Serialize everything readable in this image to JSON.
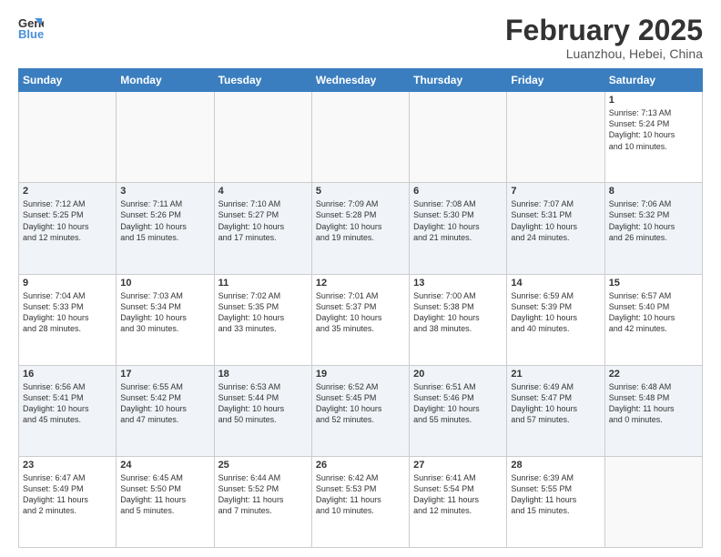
{
  "header": {
    "logo_line1": "General",
    "logo_line2": "Blue",
    "month": "February 2025",
    "location": "Luanzhou, Hebei, China"
  },
  "weekdays": [
    "Sunday",
    "Monday",
    "Tuesday",
    "Wednesday",
    "Thursday",
    "Friday",
    "Saturday"
  ],
  "weeks": [
    [
      {
        "day": "",
        "info": ""
      },
      {
        "day": "",
        "info": ""
      },
      {
        "day": "",
        "info": ""
      },
      {
        "day": "",
        "info": ""
      },
      {
        "day": "",
        "info": ""
      },
      {
        "day": "",
        "info": ""
      },
      {
        "day": "1",
        "info": "Sunrise: 7:13 AM\nSunset: 5:24 PM\nDaylight: 10 hours\nand 10 minutes."
      }
    ],
    [
      {
        "day": "2",
        "info": "Sunrise: 7:12 AM\nSunset: 5:25 PM\nDaylight: 10 hours\nand 12 minutes."
      },
      {
        "day": "3",
        "info": "Sunrise: 7:11 AM\nSunset: 5:26 PM\nDaylight: 10 hours\nand 15 minutes."
      },
      {
        "day": "4",
        "info": "Sunrise: 7:10 AM\nSunset: 5:27 PM\nDaylight: 10 hours\nand 17 minutes."
      },
      {
        "day": "5",
        "info": "Sunrise: 7:09 AM\nSunset: 5:28 PM\nDaylight: 10 hours\nand 19 minutes."
      },
      {
        "day": "6",
        "info": "Sunrise: 7:08 AM\nSunset: 5:30 PM\nDaylight: 10 hours\nand 21 minutes."
      },
      {
        "day": "7",
        "info": "Sunrise: 7:07 AM\nSunset: 5:31 PM\nDaylight: 10 hours\nand 24 minutes."
      },
      {
        "day": "8",
        "info": "Sunrise: 7:06 AM\nSunset: 5:32 PM\nDaylight: 10 hours\nand 26 minutes."
      }
    ],
    [
      {
        "day": "9",
        "info": "Sunrise: 7:04 AM\nSunset: 5:33 PM\nDaylight: 10 hours\nand 28 minutes."
      },
      {
        "day": "10",
        "info": "Sunrise: 7:03 AM\nSunset: 5:34 PM\nDaylight: 10 hours\nand 30 minutes."
      },
      {
        "day": "11",
        "info": "Sunrise: 7:02 AM\nSunset: 5:35 PM\nDaylight: 10 hours\nand 33 minutes."
      },
      {
        "day": "12",
        "info": "Sunrise: 7:01 AM\nSunset: 5:37 PM\nDaylight: 10 hours\nand 35 minutes."
      },
      {
        "day": "13",
        "info": "Sunrise: 7:00 AM\nSunset: 5:38 PM\nDaylight: 10 hours\nand 38 minutes."
      },
      {
        "day": "14",
        "info": "Sunrise: 6:59 AM\nSunset: 5:39 PM\nDaylight: 10 hours\nand 40 minutes."
      },
      {
        "day": "15",
        "info": "Sunrise: 6:57 AM\nSunset: 5:40 PM\nDaylight: 10 hours\nand 42 minutes."
      }
    ],
    [
      {
        "day": "16",
        "info": "Sunrise: 6:56 AM\nSunset: 5:41 PM\nDaylight: 10 hours\nand 45 minutes."
      },
      {
        "day": "17",
        "info": "Sunrise: 6:55 AM\nSunset: 5:42 PM\nDaylight: 10 hours\nand 47 minutes."
      },
      {
        "day": "18",
        "info": "Sunrise: 6:53 AM\nSunset: 5:44 PM\nDaylight: 10 hours\nand 50 minutes."
      },
      {
        "day": "19",
        "info": "Sunrise: 6:52 AM\nSunset: 5:45 PM\nDaylight: 10 hours\nand 52 minutes."
      },
      {
        "day": "20",
        "info": "Sunrise: 6:51 AM\nSunset: 5:46 PM\nDaylight: 10 hours\nand 55 minutes."
      },
      {
        "day": "21",
        "info": "Sunrise: 6:49 AM\nSunset: 5:47 PM\nDaylight: 10 hours\nand 57 minutes."
      },
      {
        "day": "22",
        "info": "Sunrise: 6:48 AM\nSunset: 5:48 PM\nDaylight: 11 hours\nand 0 minutes."
      }
    ],
    [
      {
        "day": "23",
        "info": "Sunrise: 6:47 AM\nSunset: 5:49 PM\nDaylight: 11 hours\nand 2 minutes."
      },
      {
        "day": "24",
        "info": "Sunrise: 6:45 AM\nSunset: 5:50 PM\nDaylight: 11 hours\nand 5 minutes."
      },
      {
        "day": "25",
        "info": "Sunrise: 6:44 AM\nSunset: 5:52 PM\nDaylight: 11 hours\nand 7 minutes."
      },
      {
        "day": "26",
        "info": "Sunrise: 6:42 AM\nSunset: 5:53 PM\nDaylight: 11 hours\nand 10 minutes."
      },
      {
        "day": "27",
        "info": "Sunrise: 6:41 AM\nSunset: 5:54 PM\nDaylight: 11 hours\nand 12 minutes."
      },
      {
        "day": "28",
        "info": "Sunrise: 6:39 AM\nSunset: 5:55 PM\nDaylight: 11 hours\nand 15 minutes."
      },
      {
        "day": "",
        "info": ""
      }
    ]
  ]
}
